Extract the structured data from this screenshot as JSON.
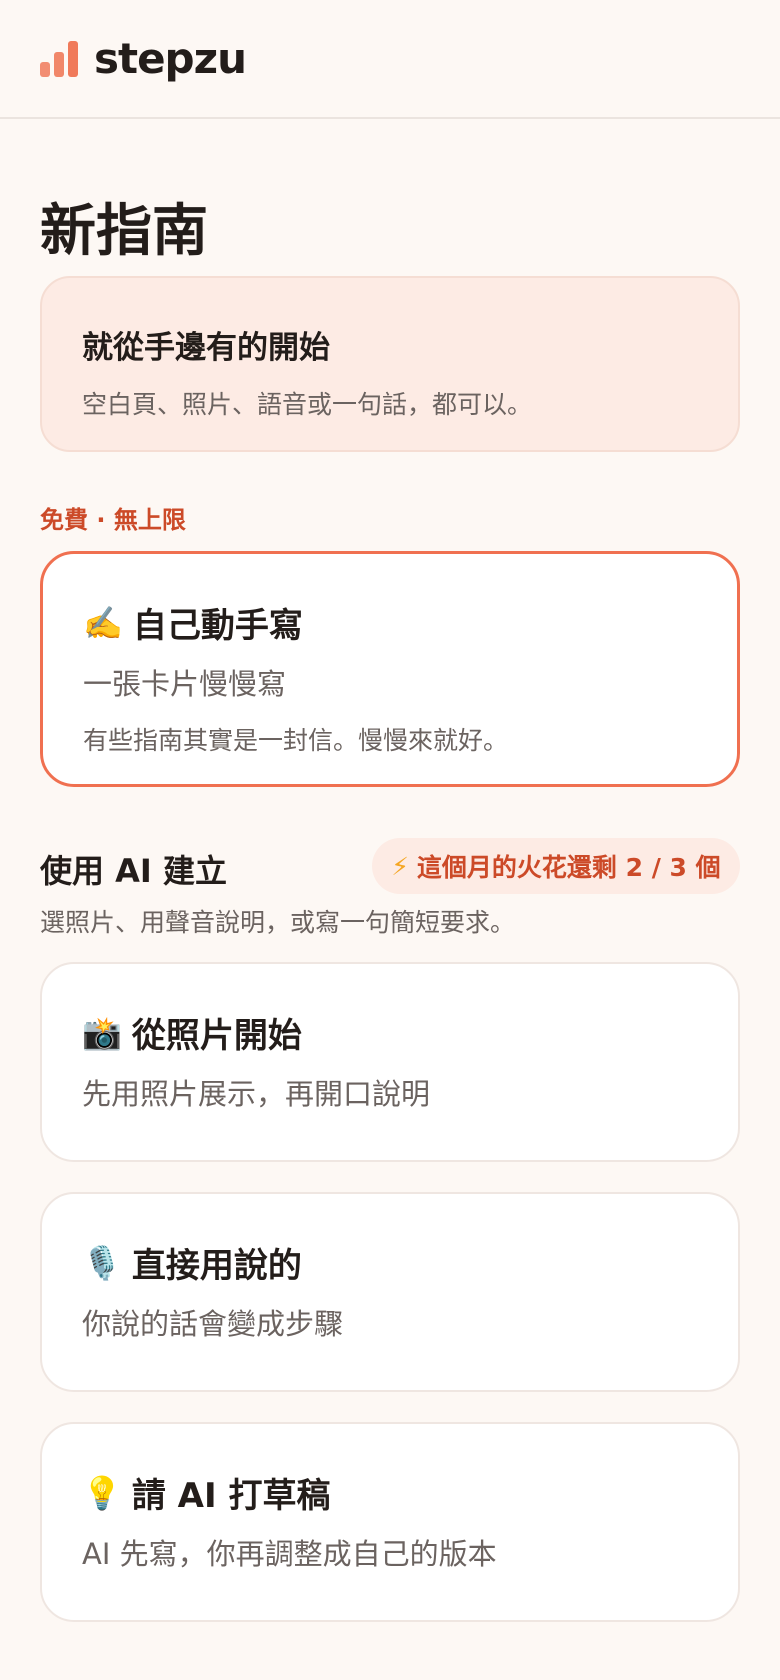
{
  "header": {
    "brand": "stepzu",
    "logo_icon": "bar-chart-icon"
  },
  "page": {
    "title": "新指南"
  },
  "intro": {
    "title": "就從手邊有的開始",
    "subtitle": "空白頁、照片、語音或一句話，都可以。"
  },
  "free_section": {
    "label": "免費 · 無上限",
    "write_card": {
      "emoji": "✍️",
      "title": "自己動手寫",
      "subtitle": "一張卡片慢慢寫",
      "note": "有些指南其實是一封信。慢慢來就好。"
    }
  },
  "ai_section": {
    "title": "使用 AI 建立",
    "badge_icon": "⚡",
    "badge": "這個月的火花還剩 2 / 3 個",
    "subtitle": "選照片、用聲音說明，或寫一句簡短要求。",
    "options": [
      {
        "emoji": "📸",
        "title": "從照片開始",
        "subtitle": "先用照片展示，再開口說明"
      },
      {
        "emoji": "🎙️",
        "title": "直接用說的",
        "subtitle": "你說的話會變成步驟"
      },
      {
        "emoji": "💡",
        "title": "請 AI 打草稿",
        "subtitle": "AI 先寫，你再調整成自己的版本"
      }
    ]
  },
  "colors": {
    "accent": "#f07050",
    "accent_text": "#cc4a28",
    "background": "#fdf8f4",
    "tint": "#fdebe4"
  }
}
